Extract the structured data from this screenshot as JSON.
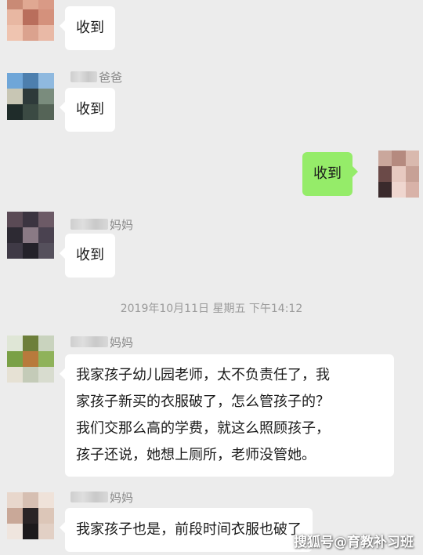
{
  "messages": [
    {
      "sender": "",
      "text": "收到",
      "side": "left"
    },
    {
      "sender": "爸爸",
      "text": "收到",
      "side": "left"
    },
    {
      "sender": "",
      "text": "收到",
      "side": "right"
    },
    {
      "sender": "妈妈",
      "text": "收到",
      "side": "left"
    },
    {
      "sender": "妈妈",
      "text": "我家孩子幼儿园老师，太不负责任了，我家孩子新买的衣服破了，怎么管孩子的？我们交那么高的学费，就这么照顾孩子，孩子还说，她想上厕所，老师没管她。",
      "lines": [
        "我家孩子幼儿园老师，太不负责任了，我",
        "家孩子新买的衣服破了，怎么管孩子的？",
        "我们交那么高的学费，就这么照顾孩子，",
        "孩子还说，她想上厕所，老师没管她。"
      ],
      "side": "left"
    },
    {
      "sender": "妈妈",
      "text": "我家孩子也是，前段时间衣服也破了",
      "side": "left"
    }
  ],
  "timestamp": "2019年10月11日 星期五 下午14:12",
  "watermark": "搜狐号@育教补习班",
  "colors": {
    "background": "#ececec",
    "bubble_left": "#ffffff",
    "bubble_right": "#95ec69",
    "name_text": "#8a8a8a",
    "timestamp_text": "#9a9a9a"
  }
}
